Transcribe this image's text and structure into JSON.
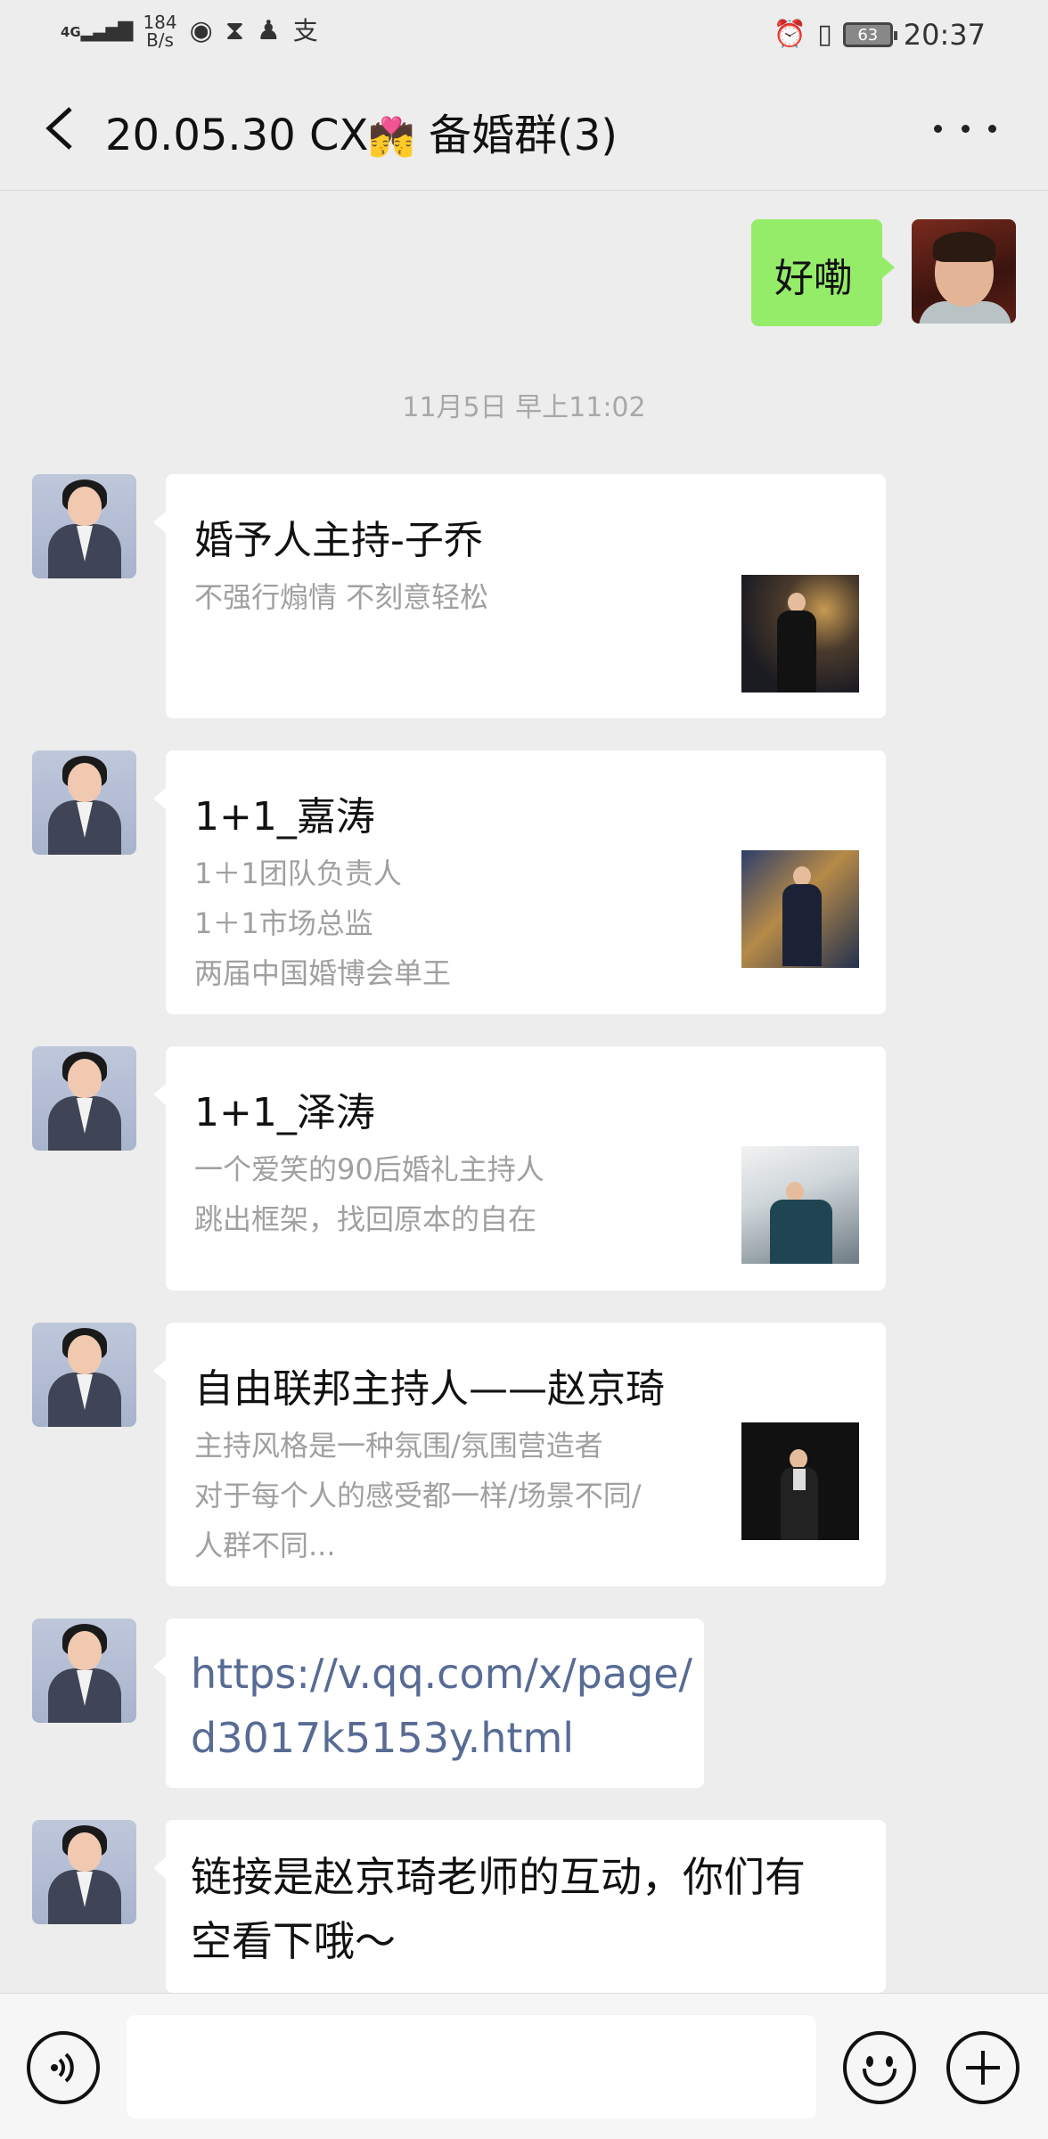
{
  "status_bar": {
    "network": "4G",
    "speed_value": "184",
    "speed_unit": "B/s",
    "battery": "63",
    "time": "20:37",
    "icons": [
      "signal-icon",
      "eye-icon",
      "hourglass-icon",
      "qq-icon",
      "alipay-icon",
      "alarm-icon",
      "vibrate-icon",
      "battery-icon"
    ]
  },
  "header": {
    "title_prefix": "20.05.30 CX",
    "title_emoji": "💏",
    "title_suffix": " 备婚群(3)"
  },
  "messages": {
    "me_reply": "好嘞",
    "timestamp": "11月5日 早上11:02",
    "cards": [
      {
        "title": "婚予人主持-子乔",
        "desc": [
          "不强行煽情  不刻意轻松"
        ]
      },
      {
        "title": "1+1_嘉涛",
        "desc": [
          "1＋1团队负责人",
          "1＋1市场总监",
          "两届中国婚博会单王"
        ]
      },
      {
        "title": "1+1_泽涛",
        "desc": [
          "一个爱笑的90后婚礼主持人",
          "跳出框架，找回原本的自在"
        ]
      },
      {
        "title": "自由联邦主持人——赵京琦",
        "desc": [
          "主持风格是一种氛围/氛围营造者",
          "对于每个人的感受都一样/场景不同/",
          "人群不同..."
        ]
      }
    ],
    "link_lines": [
      "https://v.qq.com/x/page/",
      "d3017k5153y.html"
    ],
    "last_lines": [
      "链接是赵京琦老师的互动，你们有",
      "空看下哦～"
    ]
  },
  "input_bar": {
    "placeholder": ""
  }
}
